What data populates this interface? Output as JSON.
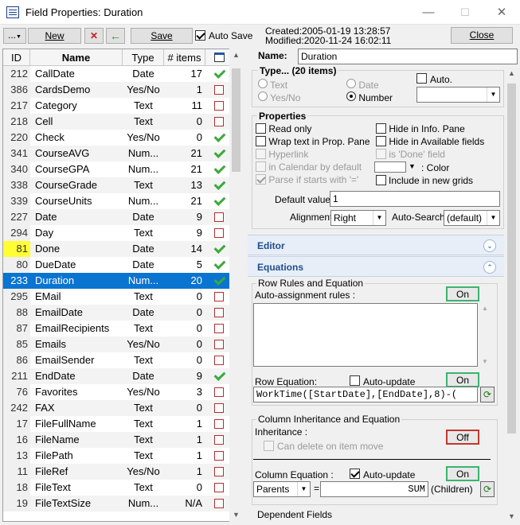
{
  "window": {
    "title": "Field Properties: Duration",
    "minimize": "—",
    "maximize": "☐",
    "close": "✕"
  },
  "toolbar": {
    "menu_label": "...",
    "new_label": "New",
    "delete_glyph": "✕",
    "back_glyph": "←",
    "save_label": "Save",
    "autosave_label": "Auto Save",
    "autosave_checked": true,
    "created": "Created:2005-01-19 13:28:57",
    "modified": "Modified:2020-11-24 16:02:11",
    "close_label": "Close"
  },
  "grid": {
    "headers": {
      "id": "ID",
      "name": "Name",
      "type": "Type",
      "items": "# items",
      "icon": "calendar-icon"
    },
    "rows": [
      {
        "id": "212",
        "name": "CallDate",
        "type": "Date",
        "items": "17",
        "flag": "check"
      },
      {
        "id": "386",
        "name": "CardsDemo",
        "type": "Yes/No",
        "items": "1",
        "flag": "box"
      },
      {
        "id": "217",
        "name": "Category",
        "type": "Text",
        "items": "11",
        "flag": "box"
      },
      {
        "id": "218",
        "name": "Cell",
        "type": "Text",
        "items": "0",
        "flag": "box"
      },
      {
        "id": "220",
        "name": "Check",
        "type": "Yes/No",
        "items": "0",
        "flag": "check"
      },
      {
        "id": "341",
        "name": "CourseAVG",
        "type": "Num...",
        "items": "21",
        "flag": "check"
      },
      {
        "id": "340",
        "name": "CourseGPA",
        "type": "Num...",
        "items": "21",
        "flag": "check"
      },
      {
        "id": "338",
        "name": "CourseGrade",
        "type": "Text",
        "items": "13",
        "flag": "check"
      },
      {
        "id": "339",
        "name": "CourseUnits",
        "type": "Num...",
        "items": "21",
        "flag": "check"
      },
      {
        "id": "227",
        "name": "Date",
        "type": "Date",
        "items": "9",
        "flag": "box"
      },
      {
        "id": "294",
        "name": "Day",
        "type": "Text",
        "items": "9",
        "flag": "box"
      },
      {
        "id": "81",
        "name": "Done",
        "type": "Date",
        "items": "14",
        "flag": "check",
        "highlight": true
      },
      {
        "id": "80",
        "name": "DueDate",
        "type": "Date",
        "items": "5",
        "flag": "check"
      },
      {
        "id": "233",
        "name": "Duration",
        "type": "Num...",
        "items": "20",
        "flag": "check",
        "selected": true
      },
      {
        "id": "295",
        "name": "EMail",
        "type": "Text",
        "items": "0",
        "flag": "box"
      },
      {
        "id": "88",
        "name": "EmailDate",
        "type": "Date",
        "items": "0",
        "flag": "box"
      },
      {
        "id": "87",
        "name": "EmailRecipients",
        "type": "Text",
        "items": "0",
        "flag": "box"
      },
      {
        "id": "85",
        "name": "Emails",
        "type": "Yes/No",
        "items": "0",
        "flag": "box"
      },
      {
        "id": "86",
        "name": "EmailSender",
        "type": "Text",
        "items": "0",
        "flag": "box"
      },
      {
        "id": "211",
        "name": "EndDate",
        "type": "Date",
        "items": "9",
        "flag": "check"
      },
      {
        "id": "76",
        "name": "Favorites",
        "type": "Yes/No",
        "items": "3",
        "flag": "box"
      },
      {
        "id": "242",
        "name": "FAX",
        "type": "Text",
        "items": "0",
        "flag": "box"
      },
      {
        "id": "17",
        "name": "FileFullName",
        "type": "Text",
        "items": "1",
        "flag": "box"
      },
      {
        "id": "16",
        "name": "FileName",
        "type": "Text",
        "items": "1",
        "flag": "box"
      },
      {
        "id": "13",
        "name": "FilePath",
        "type": "Text",
        "items": "1",
        "flag": "box"
      },
      {
        "id": "11",
        "name": "FileRef",
        "type": "Yes/No",
        "items": "1",
        "flag": "box"
      },
      {
        "id": "18",
        "name": "FileText",
        "type": "Text",
        "items": "0",
        "flag": "box"
      },
      {
        "id": "19",
        "name": "FileTextSize",
        "type": "Num...",
        "items": "N/A",
        "flag": "box"
      }
    ]
  },
  "props": {
    "name_label": "Name:",
    "name_value": "Duration",
    "type_group": "Type...  (20 items)",
    "types": {
      "text": "Text",
      "date": "Date",
      "yesno": "Yes/No",
      "number": "Number"
    },
    "auto_label": "Auto.",
    "properties_group": "Properties",
    "left_opts": [
      {
        "label": "Read only",
        "checked": false,
        "disabled": false
      },
      {
        "label": "Wrap text in Prop. Pane",
        "checked": false,
        "disabled": false
      },
      {
        "label": "Hyperlink",
        "checked": false,
        "disabled": true
      },
      {
        "label": "in Calendar by default",
        "checked": false,
        "disabled": true
      },
      {
        "label": "Parse if starts with '='",
        "checked": true,
        "disabled": true
      }
    ],
    "right_opts": [
      {
        "label": "Hide in Info. Pane",
        "checked": false,
        "disabled": false
      },
      {
        "label": "Hide in Available fields",
        "checked": false,
        "disabled": false
      },
      {
        "label": "is 'Done' field",
        "checked": false,
        "disabled": true
      }
    ],
    "color_label": ": Color",
    "include_label": "Include in new grids",
    "default_label": "Default value:",
    "default_value": "1",
    "alignment_label": "Alignment",
    "alignment_value": "Right",
    "autosearch_label": "Auto-Search:",
    "autosearch_value": "(default)",
    "editor_label": "Editor",
    "equations_label": "Equations",
    "row_rules_group": "Row Rules and Equation",
    "auto_assign_label": "Auto-assignment rules :",
    "on1": "On",
    "row_eq_label": "Row Equation:",
    "autoupdate_label": "Auto-update",
    "on2": "On",
    "row_eq_value": "WorkTime([StartDate],[EndDate],8)-(",
    "col_inh_group": "Column Inheritance and Equation",
    "inheritance_label": "Inheritance :",
    "off_label": "Off",
    "can_delete_label": "Can delete on item move",
    "col_eq_label": "Column Equation :",
    "col_autoupdate_label": "Auto-update",
    "on3": "On",
    "parents_value": "Parents",
    "equals": "=",
    "sum_value": "SUM",
    "children_label": "(Children)",
    "dependent_label": "Dependent Fields"
  }
}
